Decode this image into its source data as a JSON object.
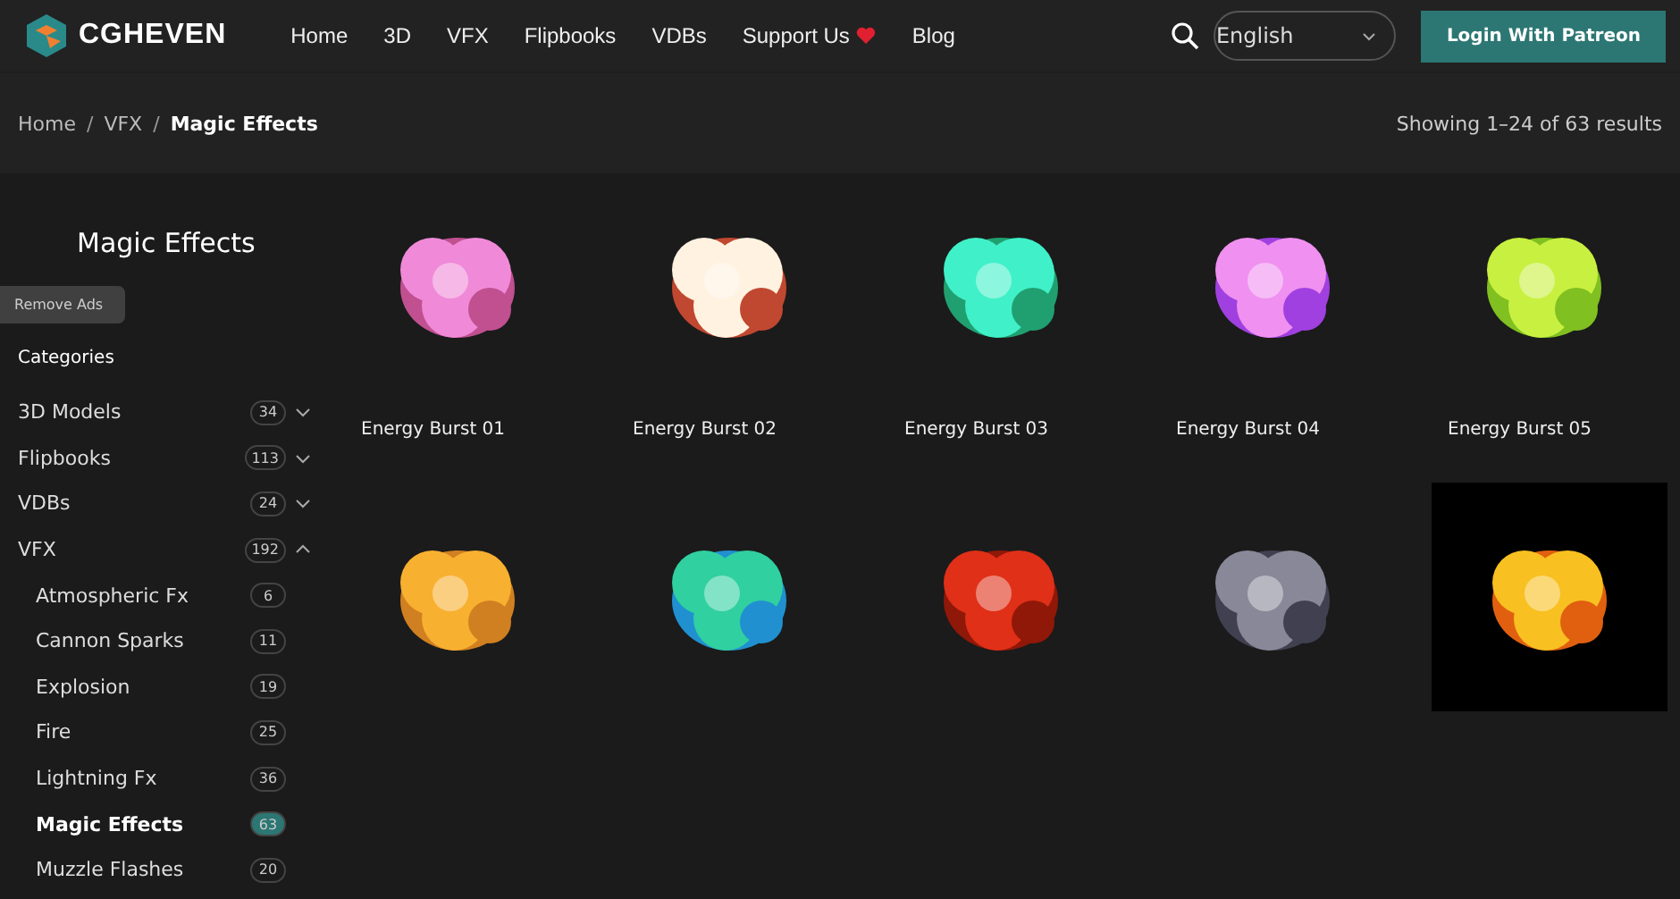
{
  "header": {
    "logo": "CGHEVEN",
    "nav": [
      {
        "label": "Home",
        "heart": false
      },
      {
        "label": "3D",
        "heart": false
      },
      {
        "label": "VFX",
        "heart": false
      },
      {
        "label": "Flipbooks",
        "heart": false
      },
      {
        "label": "VDBs",
        "heart": false
      },
      {
        "label": "Support Us",
        "heart": true
      },
      {
        "label": "Blog",
        "heart": false
      }
    ],
    "language": "English",
    "login": "Login With Patreon"
  },
  "breadcrumb": {
    "items": [
      "Home",
      "VFX"
    ],
    "separator": "/",
    "current": "Magic Effects",
    "results": "Showing 1–24 of 63 results"
  },
  "page_title": "Magic Effects",
  "sidebar": {
    "heading": "Categories",
    "items": [
      {
        "label": "3D Models",
        "count": "34",
        "expanded": false,
        "selected": false
      },
      {
        "label": "Flipbooks",
        "count": "113",
        "expanded": false,
        "selected": false
      },
      {
        "label": "VDBs",
        "count": "24",
        "expanded": false,
        "selected": false
      },
      {
        "label": "VFX",
        "count": "192",
        "expanded": true,
        "selected": false,
        "children": [
          {
            "label": "Atmospheric Fx",
            "count": "6",
            "selected": false
          },
          {
            "label": "Cannon Sparks",
            "count": "11",
            "selected": false
          },
          {
            "label": "Explosion",
            "count": "19",
            "selected": false
          },
          {
            "label": "Fire",
            "count": "25",
            "selected": false
          },
          {
            "label": "Lightning Fx",
            "count": "36",
            "selected": false
          },
          {
            "label": "Magic Effects",
            "count": "63",
            "selected": true
          },
          {
            "label": "Muzzle Flashes",
            "count": "20",
            "selected": false
          }
        ]
      }
    ]
  },
  "remove_ads": "Remove Ads",
  "products": [
    {
      "kind": "picture",
      "title": "Energy Burst 01"
    },
    {
      "kind": "picture",
      "title": "Energy Burst 02"
    },
    {
      "kind": "picture",
      "title": "Energy Burst 03"
    },
    {
      "kind": "picture",
      "title": "Energy Burst 04"
    },
    {
      "kind": "picture",
      "title": "Energy Burst 05"
    },
    {
      "kind": "picture"
    },
    {
      "kind": "picture"
    },
    {
      "kind": "picture"
    },
    {
      "kind": "picture"
    },
    {
      "kind": "picture"
    }
  ]
}
